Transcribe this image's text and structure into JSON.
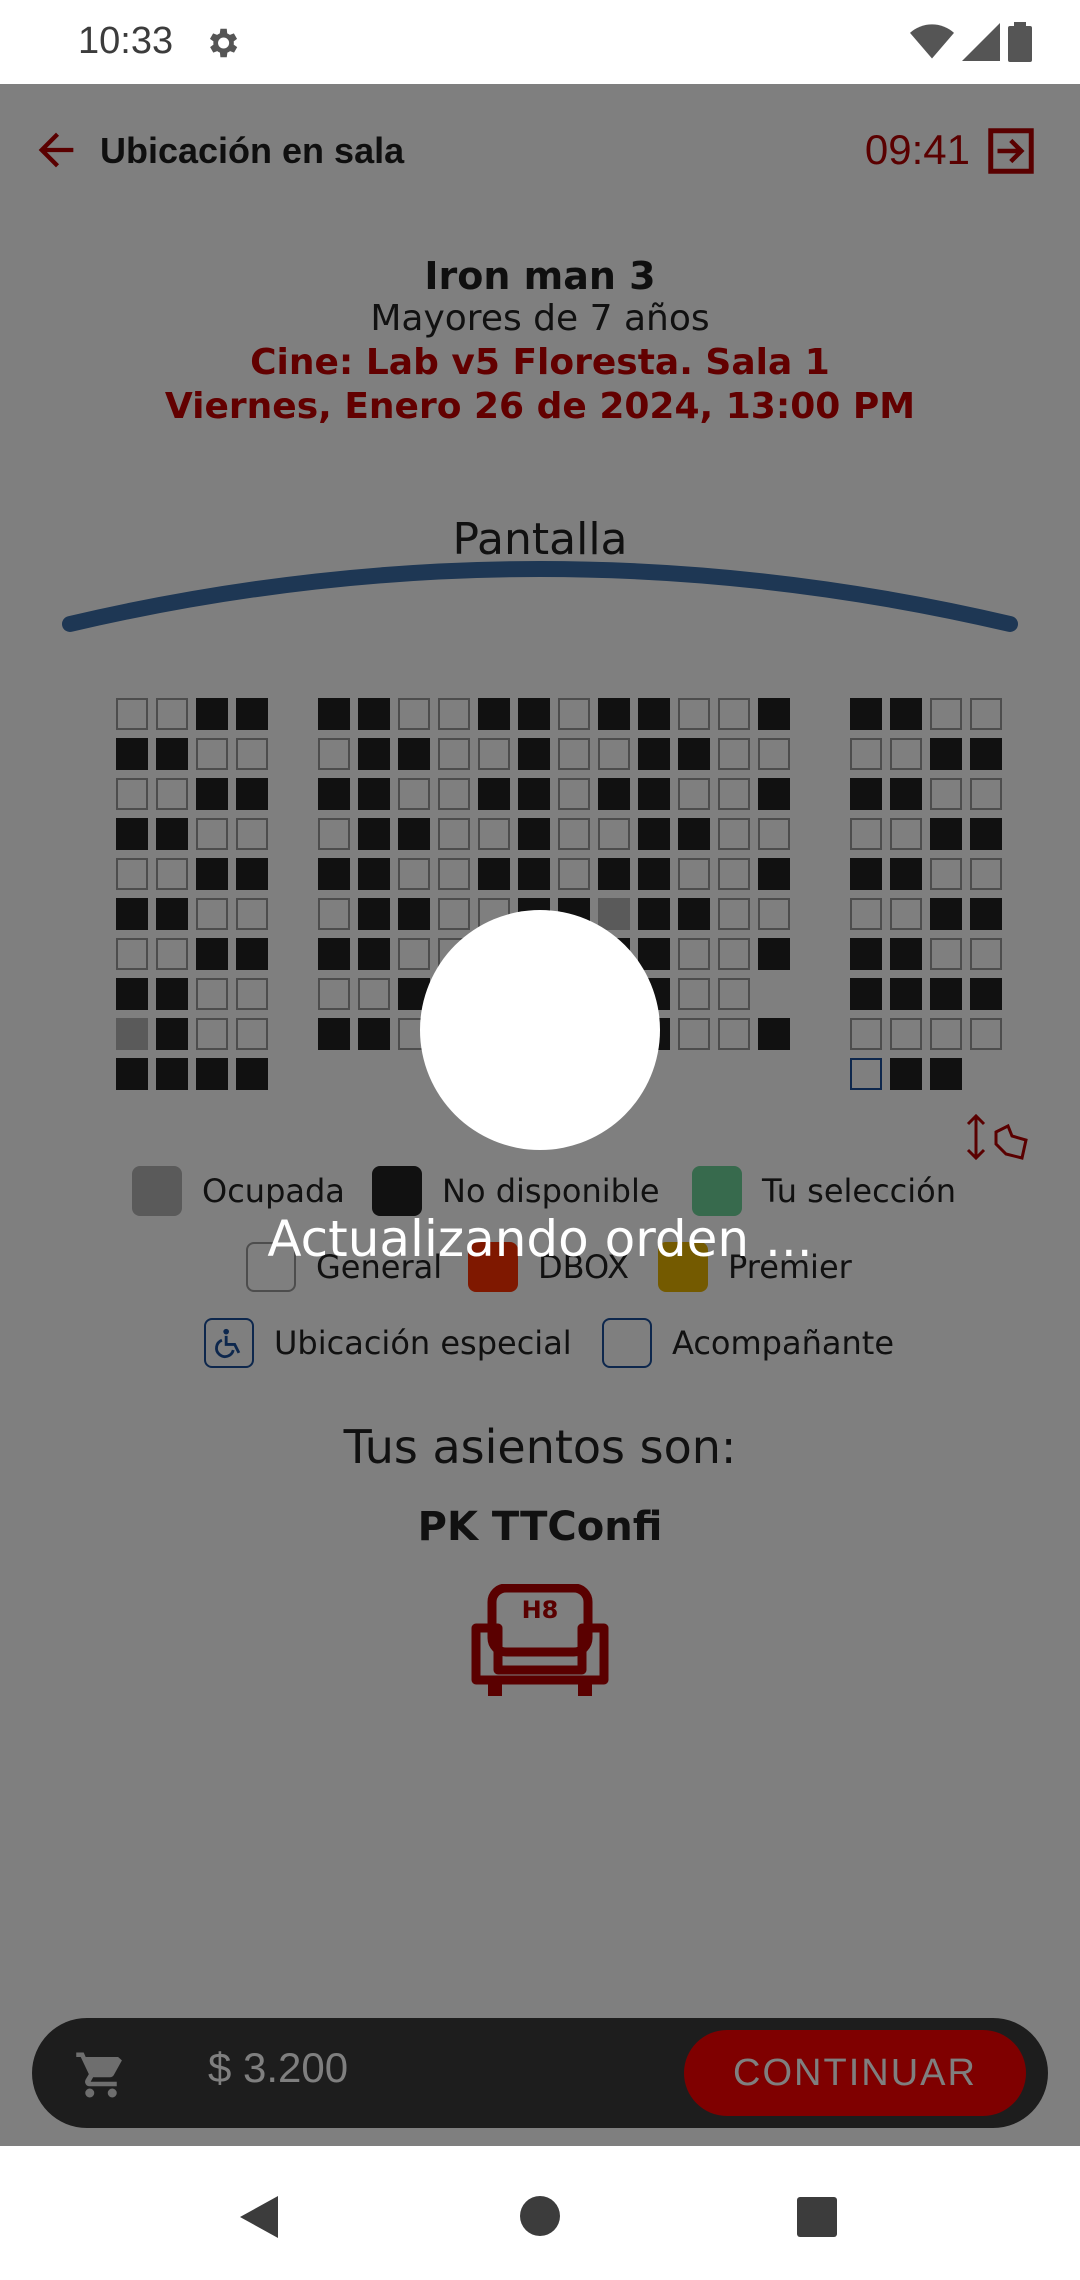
{
  "status": {
    "time": "10:33"
  },
  "header": {
    "title": "Ubicación en sala",
    "timer": "09:41"
  },
  "movie": {
    "title": "Iron man 3",
    "rating": "Mayores de 7 años",
    "cinema": "Cine: Lab v5 Floresta. Sala 1",
    "datetime": "Viernes, Enero 26 de 2024, 13:00 PM"
  },
  "screen_label": "Pantalla",
  "seatmap": {
    "left": [
      "..XX",
      "XX..",
      "..XX",
      "XX..",
      "..XX",
      "XX..",
      "..XX",
      "XX..",
      "OX..",
      "XXXX"
    ],
    "center": [
      "XX..XX.XX..X",
      ".XX..X..XX..",
      "XX..XX.XX..X",
      ".XX..X..XX..",
      "XX..XX.XX..X",
      ".XX..XXOXX..",
      "XX..XX.XX..X",
      "..XX..SXX..",
      "XX..XX.XX..X"
    ],
    "right": [
      "XX..",
      "..XX",
      "XX..",
      "..XX",
      "XX..",
      "..XX",
      "XX..",
      "XXXX",
      "....",
      "WXX"
    ]
  },
  "legend": {
    "ocupada": "Ocupada",
    "no_disponible": "No disponible",
    "seleccion": "Tu selección",
    "general": "General",
    "dbox": "DBOX",
    "premier": "Premier",
    "especial": "Ubicación especial",
    "acompanante": "Acompañante"
  },
  "selection": {
    "title": "Tus asientos son:",
    "name": "PK TTConfi",
    "seat": "H8"
  },
  "cart": {
    "price": "$ 3.200",
    "continue": "CONTINUAR"
  },
  "loading": "Actualizando orden ...",
  "colors": {
    "brand": "#b40000",
    "selected": "#6fd49a",
    "dbox": "#ff3000",
    "premier": "#e8b400"
  }
}
